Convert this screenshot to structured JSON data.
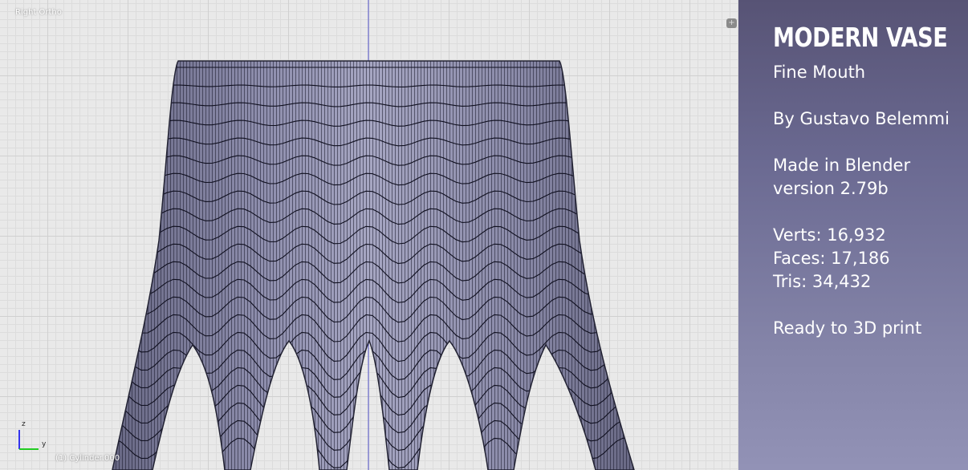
{
  "viewport": {
    "view_label": "Right Ortho",
    "object_label": "(1) Cylinder.000",
    "corner_widget_symbol": "+",
    "axes": {
      "z_label": "z",
      "y_label": "y"
    },
    "colors": {
      "grid_background": "#e9e9e9",
      "vase_body": "#8b8ba8",
      "wire": "#111122",
      "z_axis": "#3333ee",
      "y_axis": "#22cc22"
    }
  },
  "info_panel": {
    "title": "MODERN VASE",
    "subtitle": "Fine Mouth",
    "author": "By Gustavo Belemmi",
    "made_in": "Made in Blender",
    "version": "version 2.79b",
    "verts": "Verts: 16,932",
    "faces": "Faces: 17,186",
    "tris": "Tris: 34,432",
    "print_note": "Ready to 3D print",
    "colors": {
      "gradient_top": "#575375",
      "gradient_bottom": "#9292b6",
      "text": "#ffffff"
    }
  }
}
